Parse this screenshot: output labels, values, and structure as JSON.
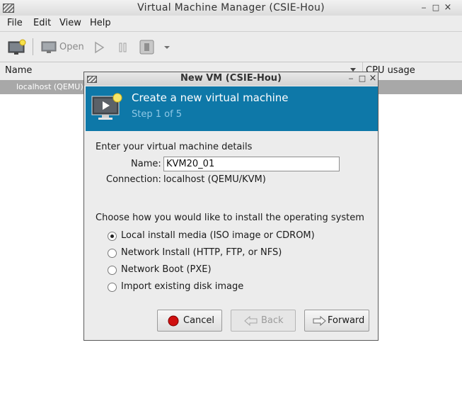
{
  "window": {
    "title": "Virtual Machine Manager (CSIE-Hou)",
    "controls": {
      "minimize": "‒",
      "maximize": "□",
      "close": "×"
    }
  },
  "menubar": [
    "File",
    "Edit",
    "View",
    "Help"
  ],
  "toolbar": {
    "open_label": "Open"
  },
  "list": {
    "columns": {
      "name": "Name",
      "cpu": "CPU usage"
    },
    "rows": [
      {
        "label": "localhost (QEMU)"
      }
    ]
  },
  "dialog": {
    "title": "New VM (CSIE-Hou)",
    "banner": {
      "title": "Create a new virtual machine",
      "subtitle": "Step 1 of 5"
    },
    "details_heading": "Enter your virtual machine details",
    "name_label": "Name:",
    "name_value": "KVM20_01",
    "connection_label": "Connection:",
    "connection_value": "localhost (QEMU/KVM)",
    "install_heading": "Choose how you would like to install the operating system",
    "install_options": [
      {
        "label": "Local install media (ISO image or CDROM)",
        "selected": true
      },
      {
        "label": "Network Install (HTTP, FTP, or NFS)",
        "selected": false
      },
      {
        "label": "Network Boot (PXE)",
        "selected": false
      },
      {
        "label": "Import existing disk image",
        "selected": false
      }
    ],
    "buttons": {
      "cancel": "Cancel",
      "back": "Back",
      "forward": "Forward"
    }
  },
  "colors": {
    "banner": "#0e78a8",
    "banner_subtitle": "#8ec8e6",
    "selection_row": "#a8a8a8",
    "cancel_icon": "#d01010"
  }
}
